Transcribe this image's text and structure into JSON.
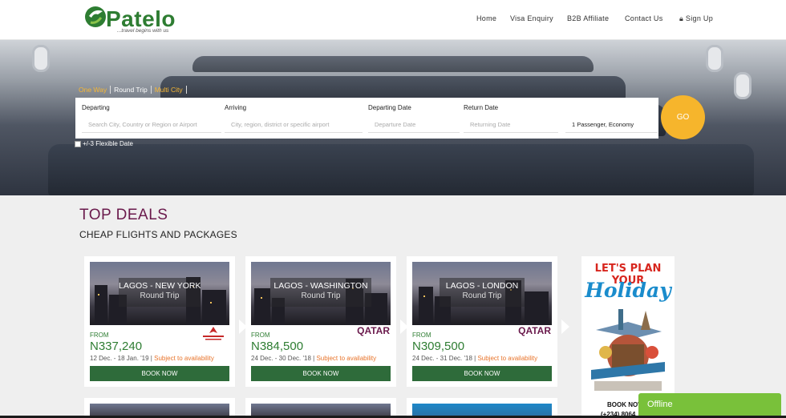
{
  "brand": {
    "name": "Patelo",
    "tagline": "...travel begins with us",
    "primary_color": "#2e7d32",
    "accent_color": "#6a1a4c"
  },
  "nav": {
    "items": [
      "Home",
      "Visa Enquiry",
      "B2B Affiliate",
      "Contact Us"
    ],
    "sign_up": "Sign Up"
  },
  "search": {
    "tabs": [
      "One Way",
      "Round Trip",
      "Multi City"
    ],
    "active_tab": "Round Trip",
    "departing_label": "Departing",
    "departing_placeholder": "Search City, Country or Region or Airport",
    "arriving_label": "Arriving",
    "arriving_placeholder": "City, region, district or specific airport",
    "departing_date_label": "Departing Date",
    "departing_date_placeholder": "Departure Date",
    "return_date_label": "Return Date",
    "return_date_placeholder": "Returning Date",
    "passengers": "1 Passenger, Economy",
    "go_label": "GO",
    "flexible_label": "+/-3 Flexible Date"
  },
  "deals": {
    "title": "TOP DEALS",
    "subtitle": "CHEAP FLIGHTS AND PACKAGES",
    "from_label": "FROM",
    "availability": "Subject to availability",
    "book_label": "BOOK NOW",
    "cards": [
      {
        "route": "LAGOS - NEW YORK",
        "trip": "Round Trip",
        "price": "N337,240",
        "dates": "12 Dec. - 18 Jan. '19",
        "airline": "royal-air-maroc-logo"
      },
      {
        "route": "LAGOS - WASHINGTON",
        "trip": "Round Trip",
        "price": "N384,500",
        "dates": "24 Dec. - 30 Dec. '18",
        "airline": "QATAR"
      },
      {
        "route": "LAGOS - LONDON",
        "trip": "Round Trip",
        "price": "N309,500",
        "dates": "24 Dec. - 31 Dec. '18",
        "airline": "QATAR"
      }
    ]
  },
  "promo": {
    "headline": "LET'S PLAN YOUR",
    "word": "Holiday",
    "book": "BOOK NOW",
    "phone": "(+234) 8064"
  },
  "chat": {
    "status": "Offline"
  }
}
